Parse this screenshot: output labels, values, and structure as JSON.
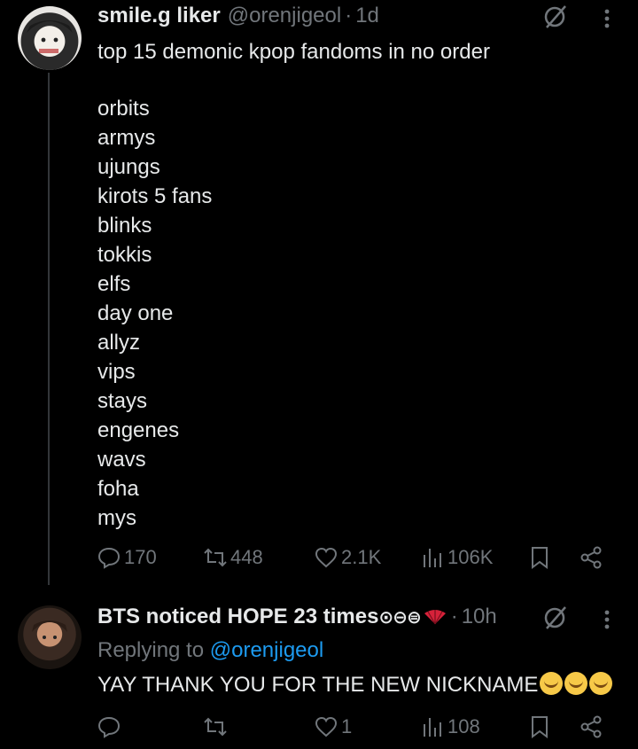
{
  "tweet": {
    "author_name": "smile.g liker",
    "handle": "@orenjigeol",
    "separator": "·",
    "time": "1d",
    "text": "top 15 demonic kpop fandoms in no order",
    "list": [
      "orbits",
      "armys",
      "ujungs",
      "kirots 5 fans",
      "blinks",
      "tokkis",
      "elfs",
      "day one",
      "allyz",
      "vips",
      "stays",
      "engenes",
      "wavs",
      "foha",
      "mys"
    ],
    "stats": {
      "replies": "170",
      "reposts": "448",
      "likes": "2.1K",
      "views": "106K"
    }
  },
  "reply": {
    "author_name": "BTS noticed HOPE 23 times",
    "name_badges": "⊙⊖⊜",
    "separator": "·",
    "time": "10h",
    "replying_label": "Replying to",
    "replying_handle": "@orenjigeol",
    "text": "YAY THANK YOU FOR THE NEW NICKNAME",
    "stats": {
      "replies": "",
      "reposts": "",
      "likes": "1",
      "views": "108"
    }
  },
  "colors": {
    "background": "#000000",
    "text": "#e7e9ea",
    "muted": "#71767b",
    "link": "#1d9bf0",
    "divider": "#333639"
  },
  "icons": [
    "grok-icon",
    "more-icon",
    "reply-icon",
    "repost-icon",
    "like-icon",
    "views-icon",
    "bookmark-icon",
    "share-icon",
    "fan-emoji",
    "yum-emoji"
  ]
}
